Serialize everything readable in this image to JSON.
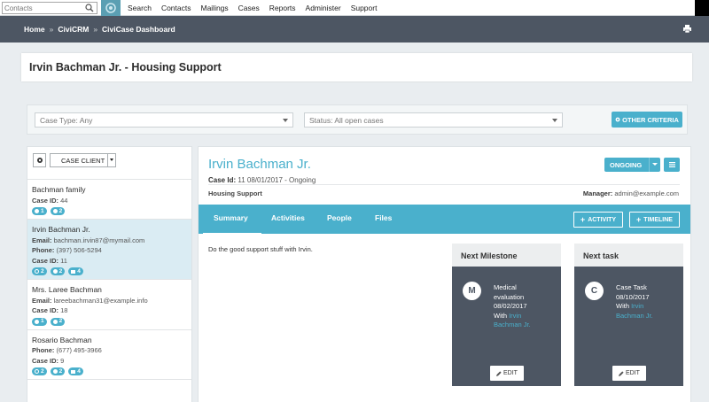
{
  "menubar": {
    "search_placeholder": "Contacts",
    "items": [
      "Search",
      "Contacts",
      "Mailings",
      "Cases",
      "Reports",
      "Administer",
      "Support"
    ]
  },
  "breadcrumb": {
    "items": [
      "Home",
      "CiviCRM",
      "CiviCase Dashboard"
    ],
    "separator": "»"
  },
  "page": {
    "title": "Irvin Bachman Jr. - Housing Support"
  },
  "filters": {
    "case_type": "Case Type: Any",
    "status": "Status: All open cases",
    "other_criteria": "OTHER CRITERIA"
  },
  "client_list": {
    "sort_label": "CASE CLIENT",
    "clients": [
      {
        "name": "Bachman family",
        "lines": [
          {
            "label": "Case ID:",
            "value": " 44"
          }
        ],
        "badges": [
          {
            "icon": "activity-icon",
            "count": "1"
          },
          {
            "icon": "comment-icon",
            "count": "2"
          }
        ]
      },
      {
        "name": "Irvin Bachman Jr.",
        "lines": [
          {
            "label": "Email:",
            "value": " bachman.irvin87@mymail.com"
          },
          {
            "label": "Phone:",
            "value": " (397) 506-5294"
          },
          {
            "label": "Case ID:",
            "value": " 11"
          }
        ],
        "badges": [
          {
            "icon": "check-icon",
            "count": "2"
          },
          {
            "icon": "comment-icon",
            "count": "2"
          },
          {
            "icon": "flag-icon",
            "count": "4"
          }
        ]
      },
      {
        "name": "Mrs. Laree Bachman",
        "lines": [
          {
            "label": "Email:",
            "value": " lareebachman31@example.info"
          },
          {
            "label": "Case ID:",
            "value": " 18"
          }
        ],
        "badges": [
          {
            "icon": "activity-icon",
            "count": "1"
          },
          {
            "icon": "comment-icon",
            "count": "2"
          }
        ]
      },
      {
        "name": "Rosario Bachman",
        "lines": [
          {
            "label": "Phone:",
            "value": " (677) 495-3966"
          },
          {
            "label": "Case ID:",
            "value": " 9"
          }
        ],
        "badges": [
          {
            "icon": "check-icon",
            "count": "2"
          },
          {
            "icon": "comment-icon",
            "count": "2"
          },
          {
            "icon": "flag-icon",
            "count": "4"
          }
        ]
      }
    ]
  },
  "detail": {
    "client_name": "Irvin Bachman Jr.",
    "case_id_label": "Case Id:",
    "case_id_value": " 11   08/01/2017 - Ongoing",
    "case_type": "Housing Support",
    "manager_label": "Manager:",
    "manager_value": " admin@example.com",
    "status_button": "ONGOING",
    "tabs": [
      "Summary",
      "Activities",
      "People",
      "Files"
    ],
    "add_activity": "ACTIVITY",
    "add_timeline": "TIMELINE",
    "summary_text": "Do the good support stuff with Irvin."
  },
  "milestone": {
    "heading": "Next Milestone",
    "letter": "M",
    "title1": "Medical",
    "title2": "evaluation",
    "date": "08/02/2017",
    "with_label": "With ",
    "with_name1": "Irvin",
    "with_name2": "Bachman Jr.",
    "edit": "EDIT"
  },
  "task": {
    "heading": "Next task",
    "letter": "C",
    "title1": "Case Task",
    "date": "08/10/2017",
    "with_label": "With ",
    "with_name1": "Irvin",
    "with_name2": "Bachman Jr.",
    "edit": "EDIT"
  },
  "colors": {
    "accent": "#4ab0cc",
    "dark": "#4d5663",
    "active_row": "#daecf3"
  }
}
